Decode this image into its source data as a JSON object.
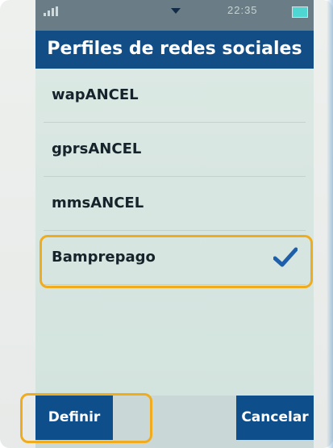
{
  "status_bar": {
    "time": "22:35"
  },
  "screen": {
    "title": "Perfiles de redes sociales"
  },
  "profiles": [
    {
      "label": "wapANCEL",
      "selected": false
    },
    {
      "label": "gprsANCEL",
      "selected": false
    },
    {
      "label": "mmsANCEL",
      "selected": false
    },
    {
      "label": "Bamprepago",
      "selected": true
    }
  ],
  "softkeys": {
    "left_label": "Definir",
    "right_label": "Cancelar"
  },
  "colors": {
    "accent_blue": "#124d86",
    "highlight_orange": "#f1ac1e",
    "check_blue": "#1f5ea8"
  }
}
